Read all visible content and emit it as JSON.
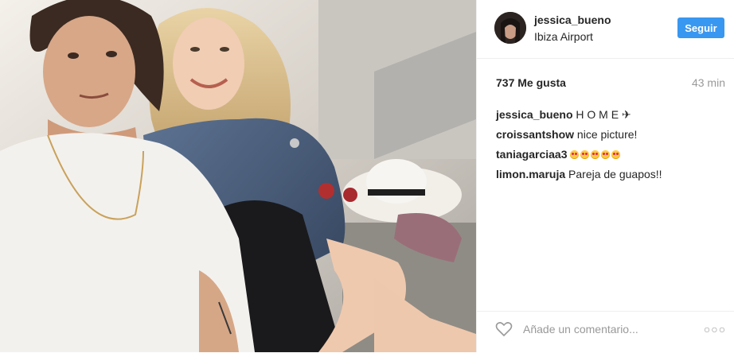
{
  "post": {
    "image_alt": "selfie photo",
    "author": {
      "username": "jessica_bueno",
      "location": "Ibiza Airport"
    },
    "follow_label": "Seguir",
    "likes": "737 Me gusta",
    "timestamp": "43 min",
    "comments": [
      {
        "author": "jessica_bueno",
        "text": "H O M E ✈"
      },
      {
        "author": "croissantshow",
        "text": "nice picture!"
      },
      {
        "author": "taniagarciaa3",
        "text": "",
        "emoji_count": 5
      },
      {
        "author": "limon.maruja",
        "text": "Pareja de guapos!!"
      }
    ],
    "comment_placeholder": "Añade un comentario...",
    "more_label": "○○○"
  },
  "colors": {
    "accent": "#3897f0",
    "text": "#262626",
    "muted": "#999999",
    "divider": "#efefef"
  },
  "icons": {
    "heart": "heart-icon",
    "more": "more-options-icon"
  }
}
